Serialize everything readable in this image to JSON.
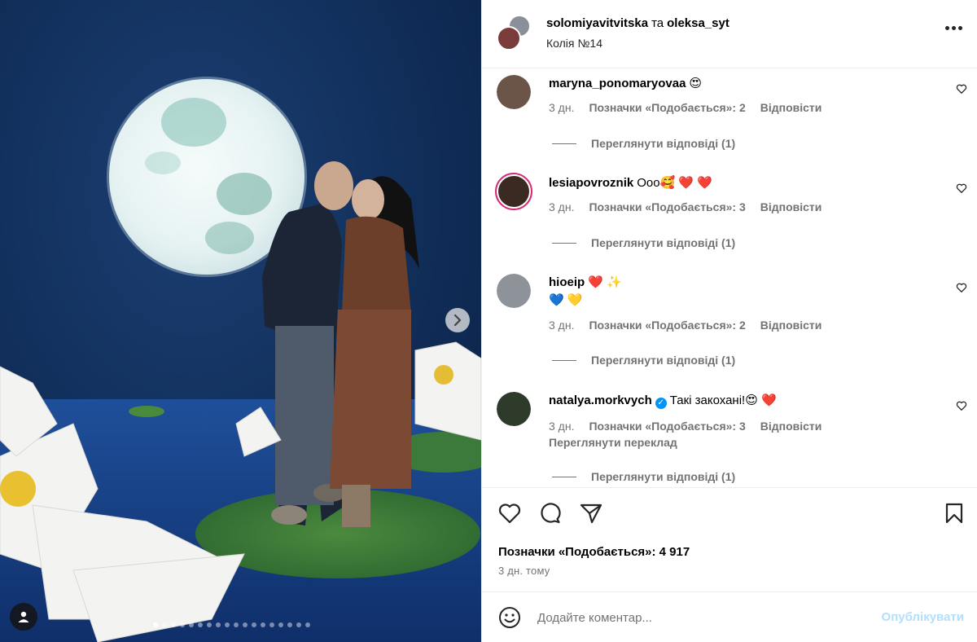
{
  "post": {
    "owner_1": "solomiyavitvitska",
    "connector": "та",
    "owner_2": "oleksa_syt",
    "audio": "Колія №14"
  },
  "comments": [
    {
      "user": "maryna_ponomaryovaa",
      "text": "😍",
      "age": "3 дн.",
      "likes": "Позначки «Подобається»: 2",
      "reply": "Відповісти",
      "view_replies": "Переглянути відповіді (1)"
    },
    {
      "user": "lesiapovroznik",
      "text": "Ооо🥰 ❤️ ❤️",
      "age": "3 дн.",
      "likes": "Позначки «Подобається»: 3",
      "reply": "Відповісти",
      "view_replies": "Переглянути відповіді (1)"
    },
    {
      "user": "hioeip",
      "text": "❤️ ✨",
      "text_line2": "💙 💛",
      "age": "3 дн.",
      "likes": "Позначки «Подобається»: 2",
      "reply": "Відповісти",
      "view_replies": "Переглянути відповіді (1)"
    },
    {
      "user": "natalya.morkvych",
      "verified_mark": "✓",
      "text": "Такі закохані!😍 ❤️",
      "age": "3 дн.",
      "likes": "Позначки «Подобається»: 3",
      "reply": "Відповісти",
      "translate": "Переглянути переклад",
      "view_replies": "Переглянути відповіді (1)"
    }
  ],
  "actions": {
    "icons": [
      "heart-icon",
      "comment-icon",
      "share-icon",
      "bookmark-icon"
    ]
  },
  "likes_total": "Позначки «Подобається»: 4 917",
  "date": "3 дн. тому",
  "add_comment": {
    "placeholder": "Додайте коментар...",
    "post_label": "Опублікувати"
  },
  "carousel": {
    "slide_count": 18,
    "active_index": 0
  },
  "colors": {
    "link_disabled": "#b2dffc",
    "secondary_text": "#737373",
    "verified": "#0095f6",
    "heart": "#e0245e"
  }
}
